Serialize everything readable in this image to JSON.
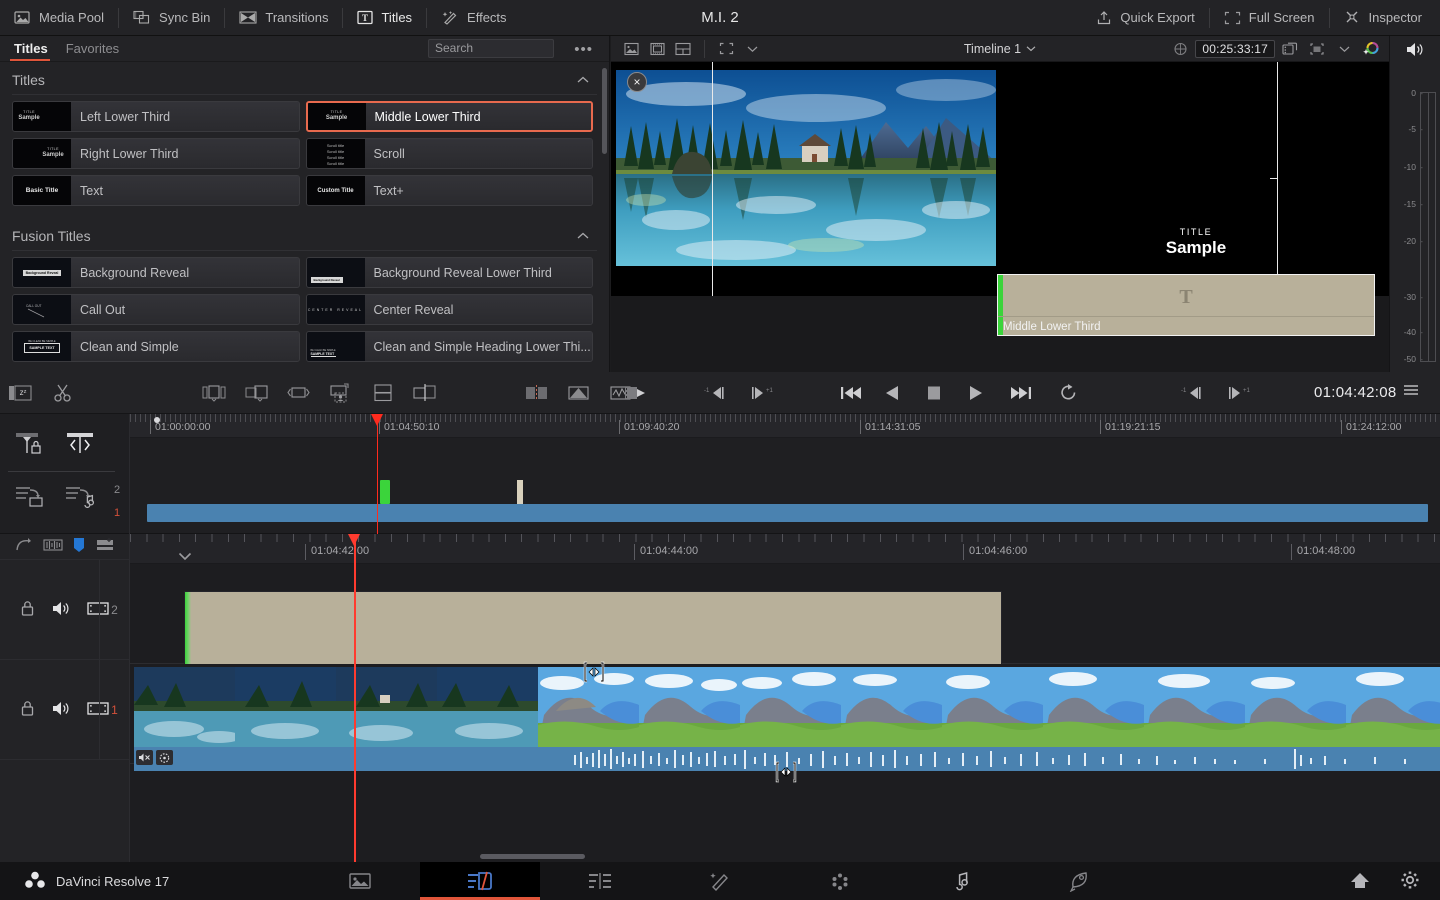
{
  "app": {
    "title": "M.I. 2",
    "product_name": "DaVinci Resolve 17"
  },
  "topbar": {
    "left_items": [
      {
        "label": "Media Pool",
        "icon": "media-pool-icon",
        "active": false
      },
      {
        "label": "Sync Bin",
        "icon": "sync-bin-icon",
        "active": false
      },
      {
        "label": "Transitions",
        "icon": "transitions-icon",
        "active": false
      },
      {
        "label": "Titles",
        "icon": "titles-icon",
        "active": true
      },
      {
        "label": "Effects",
        "icon": "effects-icon",
        "active": false
      }
    ],
    "right_items": [
      {
        "label": "Quick Export",
        "icon": "quick-export-icon"
      },
      {
        "label": "Full Screen",
        "icon": "full-screen-icon"
      },
      {
        "label": "Inspector",
        "icon": "inspector-icon"
      }
    ]
  },
  "library": {
    "tabs": [
      {
        "label": "Titles",
        "active": true
      },
      {
        "label": "Favorites",
        "active": false
      }
    ],
    "search_placeholder": "Search",
    "search_value": "",
    "options_label": "•••",
    "sections": [
      {
        "name": "Titles",
        "collapsed": false,
        "items": [
          {
            "label": "Left Lower Third",
            "selected": false,
            "favorite": false,
            "thumb": "title-sample-left"
          },
          {
            "label": "Middle Lower Third",
            "selected": true,
            "favorite": false,
            "thumb": "title-sample-middle"
          },
          {
            "label": "Right Lower Third",
            "selected": false,
            "favorite": false,
            "thumb": "title-sample-right"
          },
          {
            "label": "Scroll",
            "selected": false,
            "favorite": false,
            "thumb": "scroll-lines"
          },
          {
            "label": "Text",
            "selected": false,
            "favorite": false,
            "thumb": "basic-title"
          },
          {
            "label": "Text+",
            "selected": false,
            "favorite": false,
            "thumb": "custom-title"
          }
        ]
      },
      {
        "name": "Fusion Titles",
        "collapsed": false,
        "items": [
          {
            "label": "Background Reveal",
            "selected": false,
            "favorite": false,
            "thumb": "background-reveal"
          },
          {
            "label": "Background Reveal Lower Third",
            "selected": false,
            "favorite": false,
            "thumb": "background-reveal-lower"
          },
          {
            "label": "Call Out",
            "selected": false,
            "favorite": false,
            "thumb": "call-out"
          },
          {
            "label": "Center Reveal",
            "selected": false,
            "favorite": false,
            "thumb": "center-reveal"
          },
          {
            "label": "Clean and Simple",
            "selected": false,
            "favorite": false,
            "thumb": "clean-simple"
          },
          {
            "label": "Clean and Simple Heading Lower Thi...",
            "selected": false,
            "favorite": true,
            "thumb": "clean-simple-heading"
          }
        ]
      }
    ]
  },
  "viewer": {
    "timeline_name": "Timeline 1",
    "duration_timecode": "00:25:33:17",
    "close_label": "×",
    "overlay_title_line1": "TITLE",
    "overlay_title_line2": "Sample",
    "drag_clip_name": "Middle Lower Third",
    "drag_clip_glyph": "T"
  },
  "meters": {
    "scale": [
      "0",
      "-5",
      "-10",
      "-15",
      "-20",
      "-30",
      "-40",
      "-50"
    ],
    "channels": 2
  },
  "transport": {
    "current_timecode": "01:04:42:08",
    "buttons": [
      "source-tape-icon",
      "step-back-frame-icon",
      "step-forward-frame-icon",
      "jump-start-icon",
      "play-reverse-icon",
      "stop-icon",
      "play-icon",
      "jump-end-icon",
      "loop-icon"
    ]
  },
  "mini_timeline": {
    "ruler_labels": [
      "01:00:00:00",
      "01:04:50:10",
      "01:09:40:20",
      "01:14:31:05",
      "01:19:21:15",
      "01:24:12:00"
    ],
    "track_numbers": [
      "2",
      "1"
    ],
    "selected_track": "1",
    "playhead_label": "01:04:50:10"
  },
  "timeline": {
    "ruler_labels": [
      "01:04:42:00",
      "01:04:44:00",
      "01:04:46:00",
      "01:04:48:00"
    ],
    "tracks": [
      {
        "number": "2",
        "selected": false,
        "lock": "lock-icon",
        "audio": "speaker-icon",
        "video": "filmstrip-icon"
      },
      {
        "number": "1",
        "selected": true,
        "lock": "lock-icon",
        "audio": "speaker-icon",
        "video": "filmstrip-icon"
      }
    ],
    "title_clip": {
      "name": "Middle Lower Third",
      "badge": "T"
    },
    "audio_clip": {
      "mute_icon": "audio-mute-icon",
      "link_icon": "clip-link-icon"
    }
  },
  "bottombar": {
    "brand": "DaVinci Resolve 17",
    "pages": [
      {
        "name": "media",
        "icon": "media-page-icon",
        "active": false
      },
      {
        "name": "cut",
        "icon": "cut-page-icon",
        "active": true
      },
      {
        "name": "edit",
        "icon": "edit-page-icon",
        "active": false
      },
      {
        "name": "fusion",
        "icon": "fusion-page-icon",
        "active": false
      },
      {
        "name": "color",
        "icon": "color-page-icon",
        "active": false
      },
      {
        "name": "fairlight",
        "icon": "fairlight-page-icon",
        "active": false
      },
      {
        "name": "deliver",
        "icon": "deliver-page-icon",
        "active": false
      }
    ],
    "right": [
      {
        "name": "home",
        "icon": "home-icon"
      },
      {
        "name": "settings",
        "icon": "gear-icon"
      }
    ]
  },
  "colors": {
    "accent": "#e0553a",
    "selection": "#e86a4e",
    "playhead": "#ff3b2f",
    "title_clip": "#b8b09a",
    "video_clip": "#4a82b0",
    "track_green": "#3bd43b",
    "panel_bg": "#232326",
    "timeline_bg": "#1d1d20"
  }
}
